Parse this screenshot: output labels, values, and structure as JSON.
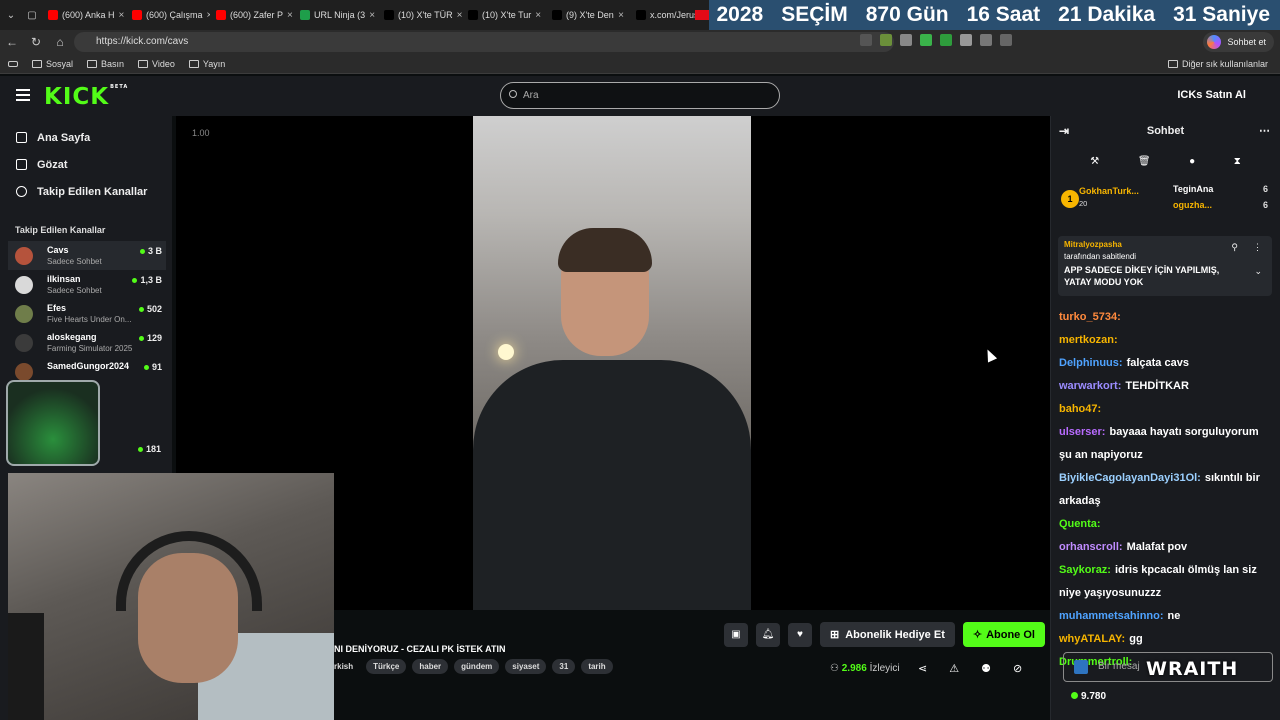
{
  "browser": {
    "tabs": [
      {
        "label": "(600) Anka H",
        "color": "#ff0000"
      },
      {
        "label": "(600) Çalışma",
        "color": "#ff0000"
      },
      {
        "label": "(600) Zafer P",
        "color": "#ff0000"
      },
      {
        "label": "URL Ninja (3",
        "color": "#1e9e4a"
      },
      {
        "label": "(10) X'te TÜR",
        "color": "#000000"
      },
      {
        "label": "(10) X'te Tur",
        "color": "#000000"
      },
      {
        "label": "(9) X'te Den",
        "color": "#000000"
      },
      {
        "label": "x.com/Jerusa",
        "color": "#000000"
      }
    ],
    "countdown": [
      "2028",
      "SEÇİM",
      "870 Gün",
      "16 Saat",
      "21 Dakika",
      "31 Saniye"
    ],
    "url": "https://kick.com/cavs",
    "sync_label": "Sohbet et",
    "bookmarks": [
      "Sosyal",
      "Basın",
      "Video",
      "Yayın"
    ],
    "other_bookmarks": "Diğer sık kullanılanlar"
  },
  "header": {
    "logo": "KICK",
    "logo_badge": "BETA",
    "search_placeholder": "Ara",
    "right_text": "ICKs Satın Al"
  },
  "sidebar": {
    "nav": [
      "Ana Sayfa",
      "Gözat",
      "Takip Edilen Kanallar"
    ],
    "section_title": "Takip Edilen Kanallar",
    "channels": [
      {
        "name": "Cavs",
        "sub": "Sadece Sohbet",
        "viewers": "3 B",
        "color": "#b5533c"
      },
      {
        "name": "ilkinsan",
        "sub": "Sadece Sohbet",
        "viewers": "1,3 B",
        "color": "#d9d9d9"
      },
      {
        "name": "Efes",
        "sub": "Five Hearts Under On...",
        "viewers": "502",
        "color": "#6f7d4a"
      },
      {
        "name": "aloskegang",
        "sub": "Farming Simulator 2025",
        "viewers": "129",
        "color": "#3b3b3b"
      },
      {
        "name": "SamedGungor2024",
        "sub": "",
        "viewers": "91",
        "color": "#7a4a2d"
      }
    ],
    "extra_viewers": "181"
  },
  "player": {
    "quality": "1.00"
  },
  "stream": {
    "title": "NI DENİYORUZ - CEZALI PK İSTEK ATIN",
    "tags": [
      "rkish",
      "Türkçe",
      "haber",
      "gündem",
      "siyaset",
      "31",
      "tarih"
    ],
    "gift_label": "Abonelik Hediye Et",
    "subscribe_label": "Abone Ol",
    "viewers": "2.986",
    "viewers_label": "İzleyici"
  },
  "chat": {
    "title": "Sohbet",
    "leaderboard": [
      {
        "name": "GokhanTurk...",
        "count": "20"
      },
      {
        "name": "TeginAna",
        "count": "6"
      },
      {
        "name": "oguzha...",
        "count": "6"
      }
    ],
    "pinned_by": "Mitralyozpasha",
    "pinned_label": "tarafından sabitlendi",
    "pinned_message": "APP SADECE DİKEY İÇİN YAPILMIŞ, YATAY MODU YOK",
    "messages": [
      {
        "user": "turko_5734:",
        "text": "",
        "color": "#ff8a3d"
      },
      {
        "user": "mertkozan:",
        "text": "",
        "color": "#f7b500"
      },
      {
        "user": "Delphinuus:",
        "text": "falçata cavs",
        "color": "#4fa3ff"
      },
      {
        "user": "warwarkort:",
        "text": "TEHDİTKAR",
        "color": "#9b8cff"
      },
      {
        "user": "baho47:",
        "text": "",
        "color": "#f7b500"
      },
      {
        "user": "ulserser:",
        "text": "bayaaa hayatı sorguluyorum şu an napiyoruz",
        "color": "#b86bff"
      },
      {
        "user": "BiyikleCagolayanDayi31Ol:",
        "text": "sıkıntılı bir arkadaş",
        "color": "#9bd0ff"
      },
      {
        "user": "Quenta:",
        "text": "",
        "color": "#53fc18"
      },
      {
        "user": "orhanscroll:",
        "text": "Malafat pov",
        "color": "#c08cff"
      },
      {
        "user": "Saykoraz:",
        "text": "idris kpcacalı ölmüş lan siz niye yaşıyosunuzzz",
        "color": "#53fc18"
      },
      {
        "user": "muhammetsahinno:",
        "text": "ne",
        "color": "#4fa3ff"
      },
      {
        "user": "whyATALAY:",
        "text": "gg",
        "color": "#f7b500"
      },
      {
        "user": "Drummertroll:",
        "text": "",
        "color": "#53fc18"
      }
    ],
    "input_placeholder": "Bir mesaj",
    "points": "9.780"
  },
  "overlay": {
    "brand": "WRAITH"
  }
}
